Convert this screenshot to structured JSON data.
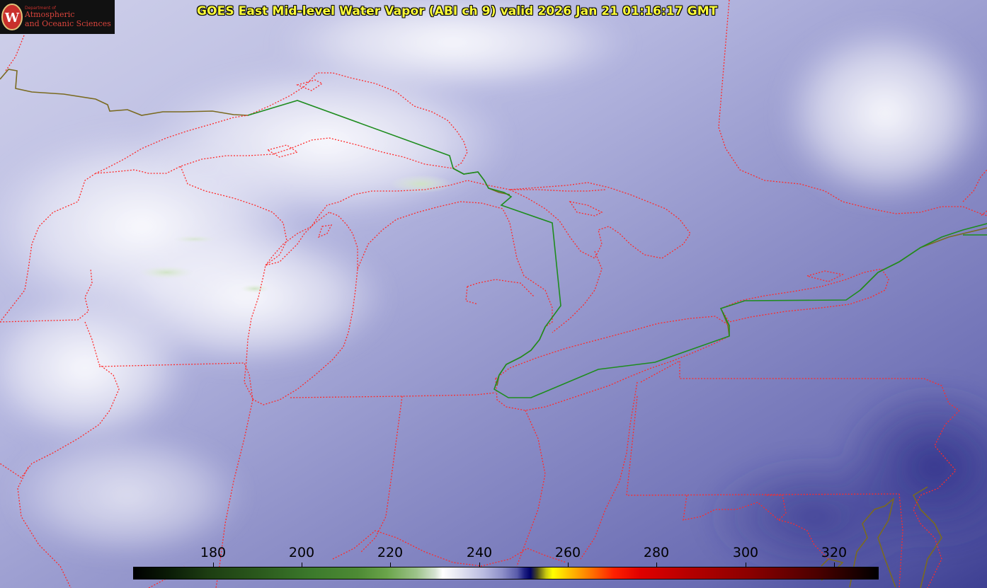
{
  "title": "GOES East Mid-level Water Vapor (ABI ch 9)  valid 2026 Jan 21 01:16:17 GMT",
  "logo": {
    "department": "Department of",
    "name_line1": "Atmospheric",
    "name_line2": "and Oceanic Sciences",
    "seal_letter": "W"
  },
  "colorbar": {
    "labels": [
      "180",
      "200",
      "220",
      "240",
      "260",
      "280",
      "300",
      "320"
    ]
  },
  "colors": {
    "state_borders": "#ff2a2a",
    "international_border": "#1e8c1e",
    "coastline": "#7a6a20",
    "title": "#ffff3a"
  }
}
